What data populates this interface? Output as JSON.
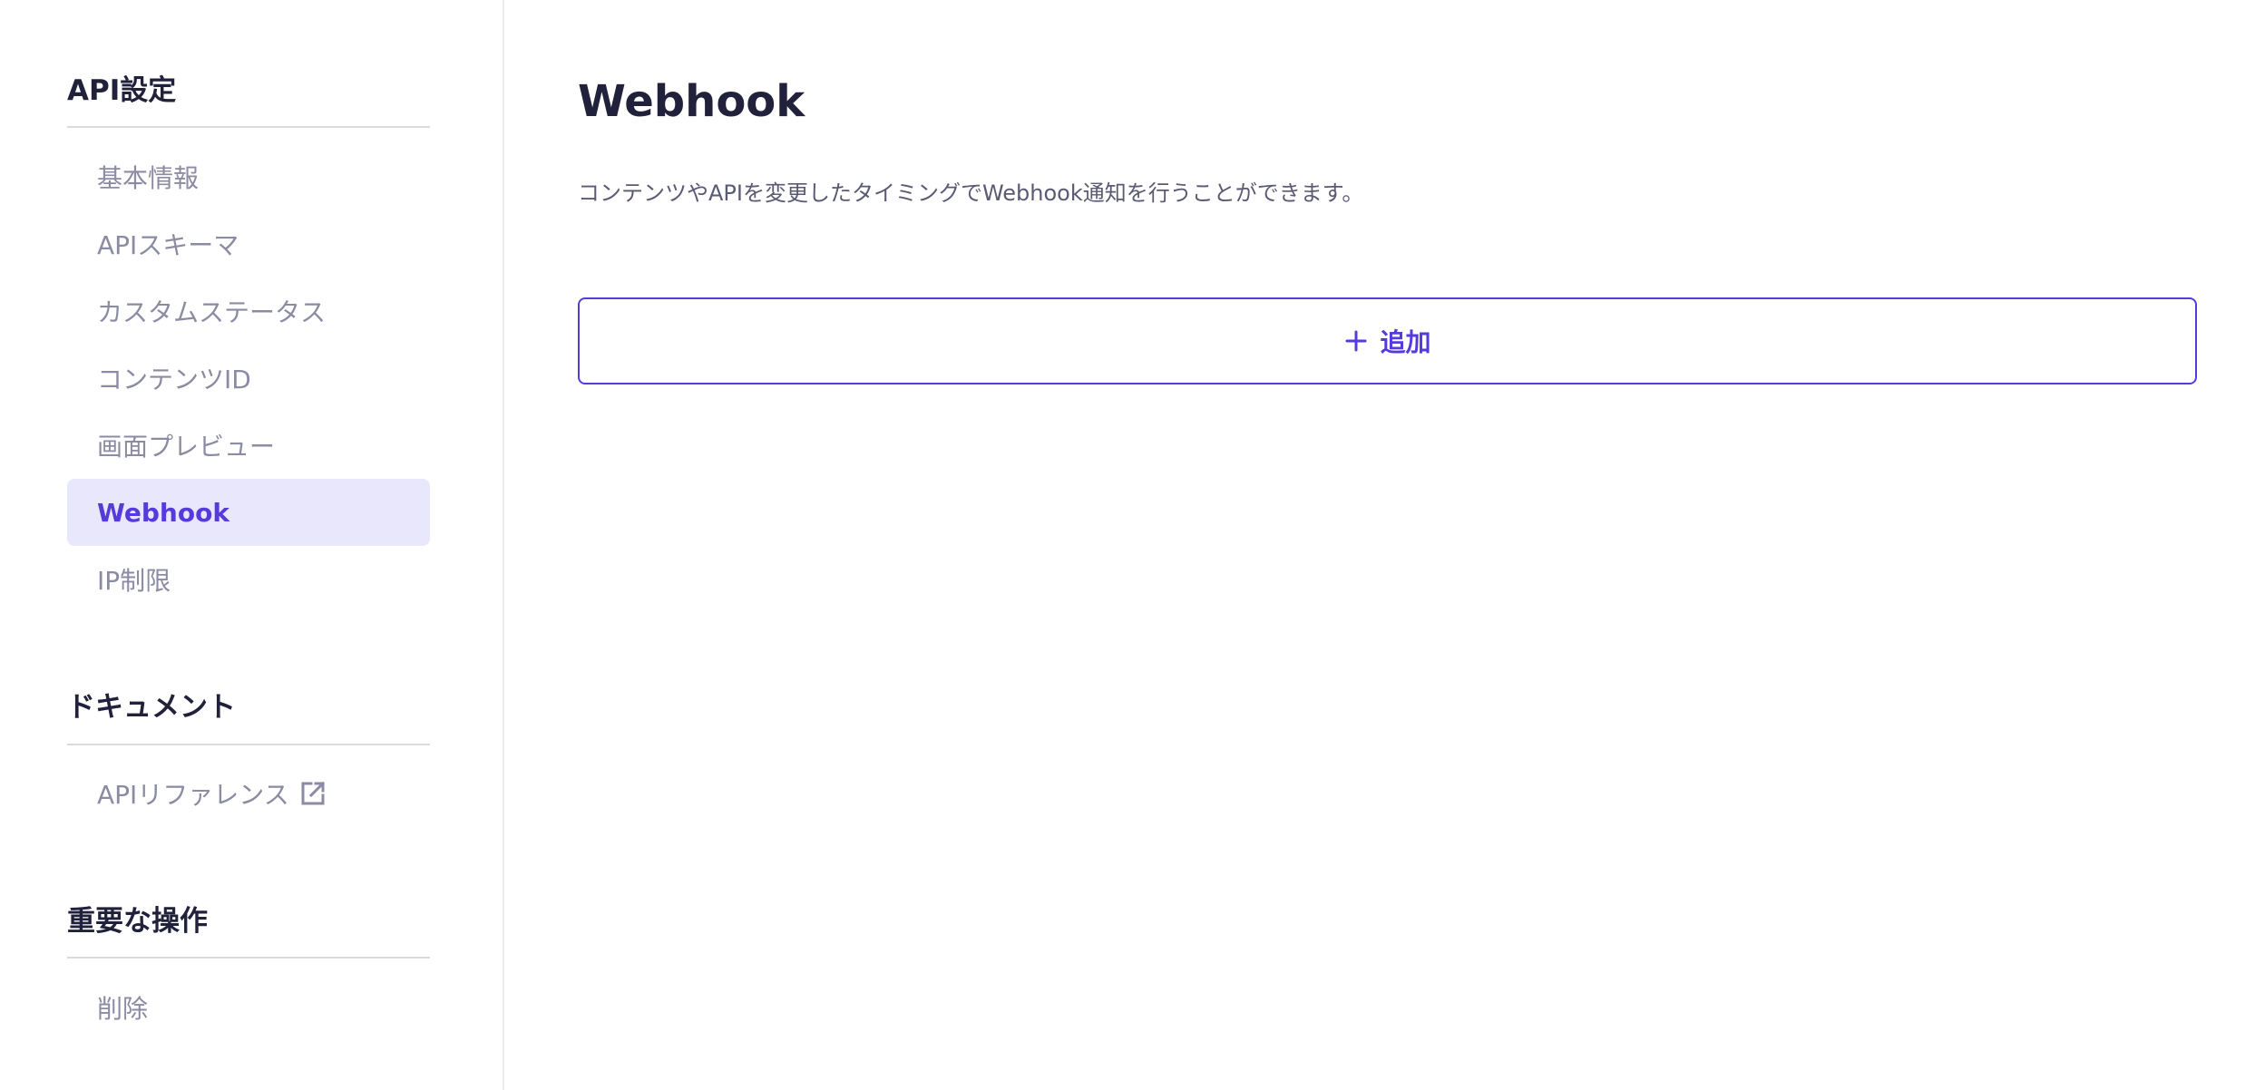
{
  "sidebar": {
    "sections": [
      {
        "heading": "API設定",
        "items": [
          {
            "label": "基本情報",
            "active": false
          },
          {
            "label": "APIスキーマ",
            "active": false
          },
          {
            "label": "カスタムステータス",
            "active": false
          },
          {
            "label": "コンテンツID",
            "active": false
          },
          {
            "label": "画面プレビュー",
            "active": false
          },
          {
            "label": "Webhook",
            "active": true
          },
          {
            "label": "IP制限",
            "active": false
          }
        ]
      },
      {
        "heading": "ドキュメント",
        "items": [
          {
            "label": "APIリファレンス",
            "icon": "external-link-icon"
          }
        ]
      },
      {
        "heading": "重要な操作",
        "items": [
          {
            "label": "削除"
          }
        ]
      }
    ]
  },
  "main": {
    "title": "Webhook",
    "description": "コンテンツやAPIを変更したタイミングでWebhook通知を行うことができます。",
    "add_button": {
      "label": "追加",
      "icon": "plus-icon"
    }
  },
  "colors": {
    "accent": "#563bdc",
    "active_bg": "#e9e7fb",
    "muted_text": "#8b8ba3",
    "heading_text": "#21213b"
  }
}
